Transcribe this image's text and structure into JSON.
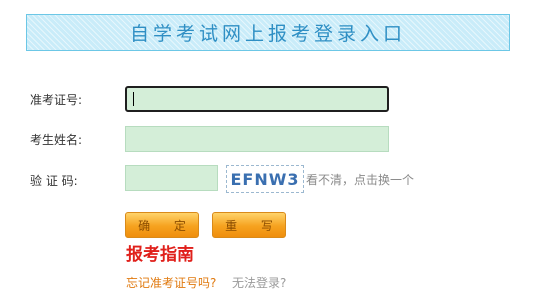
{
  "header": {
    "title": "自学考试网上报考登录入口"
  },
  "form": {
    "id_label": "准考证号:",
    "id_value": "",
    "name_label": "考生姓名:",
    "name_value": "",
    "code_label": "验 证 码:",
    "code_value": "",
    "captcha_text": "EFNW3",
    "refresh_text": "看不清，点击换一个"
  },
  "buttons": {
    "confirm_label": "确 定",
    "reset_label": "重 写"
  },
  "links": {
    "guide": "报考指南",
    "forgot": "忘记准考证号吗?",
    "cannot_login": "无法登录?"
  },
  "colors": {
    "accent_blue": "#2f8fc4",
    "input_bg": "#d4eed8",
    "button_orange": "#f6a21f",
    "guide_red": "#e0201b",
    "forgot_orange": "#e07a10"
  }
}
